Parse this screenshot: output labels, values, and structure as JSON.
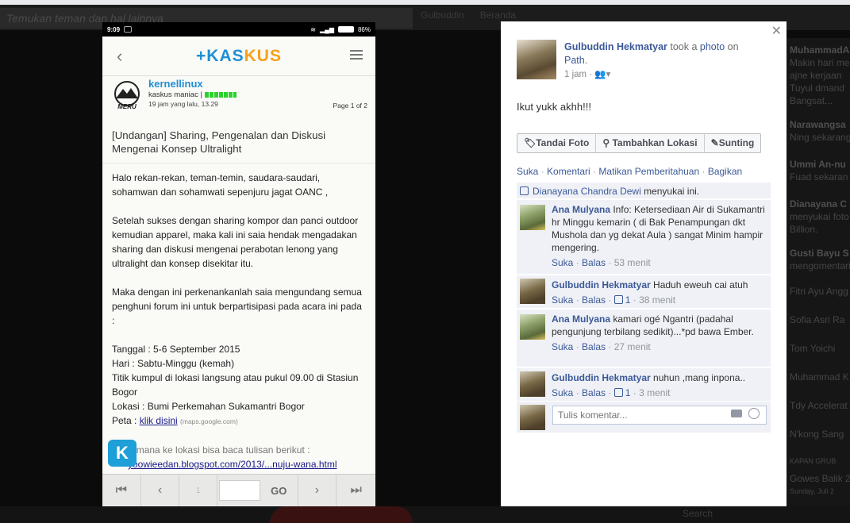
{
  "background": {
    "search_placeholder": "Temukan teman dan hal lainnya",
    "tabs": [
      "Gulbuddin",
      "Beranda"
    ],
    "sidebar": [
      {
        "name": "MuhammadA",
        "sub": "Makin hari me"
      },
      {
        "name": "",
        "sub": "ajne kerjaan"
      },
      {
        "name": "",
        "sub": "Tuyul dmand"
      },
      {
        "name": "",
        "sub": "Bangsat..."
      },
      {
        "name": "Narawangsa",
        "sub": "Ning sekarang"
      },
      {
        "name": "Ummi An-nu",
        "sub": "Fuad sekaran"
      },
      {
        "name": "Dianayana C",
        "sub": "menyukai foto"
      },
      {
        "name": "",
        "sub": "Billion."
      },
      {
        "name": "Gusti Bayu S",
        "sub": "mengomentari"
      },
      {
        "name": "",
        "sub": "Fitri Ayu Angg"
      },
      {
        "name": "",
        "sub": "Sofia Asri Ra"
      },
      {
        "name": "",
        "sub": "Tom Yoichi"
      },
      {
        "name": "",
        "sub": "Muhammad K"
      },
      {
        "name": "",
        "sub": "Tdy Accelerat"
      },
      {
        "name": "",
        "sub": "N'kong Sang"
      },
      {
        "name": "",
        "sub": "KAPAN GRUB"
      },
      {
        "name": "",
        "sub": "Gowes Balik 2"
      },
      {
        "name": "",
        "sub": "Sunday, Juli 2"
      }
    ],
    "bottom_right": "Search"
  },
  "phone": {
    "status_time": "9:09",
    "battery": "86%",
    "logo_prefix": "+KAS",
    "logo_suffix": "KUS",
    "username": "kernellinux",
    "rank": "kaskus maniac |",
    "post_time": "19 jam yang lalu, 13.29",
    "page": "Page 1 of 2",
    "title": "[Undangan] Sharing, Pengenalan dan Diskusi Mengenai Konsep Ultralight",
    "para1": "Halo rekan-rekan, teman-temin, saudara-saudari, sohamwan dan sohamwati sepenjuru jagat OANC ,",
    "para2": "Setelah sukses dengan sharing kompor dan panci outdoor kemudian apparel, maka kali ini saia hendak mengadakan sharing dan diskusi mengenai perabotan lenong yang ultralight dan konsep disekitar itu.",
    "para3": "Maka dengan ini perkenankanlah saia mengundang semua penghuni forum ini untuk berpartisipasi pada acara ini pada :",
    "tanggal": "Tanggal : 5-6 September 2015",
    "hari": "Hari : Sabtu-Minggu (kemah)",
    "titik": "Titik kumpul di lokasi langsung atau pukul 09.00 di Stasiun Bogor",
    "lokasi": "Lokasi : Bumi Perkemahan Sukamantri Bogor",
    "peta_label": "Peta : ",
    "peta_link": "klik disini",
    "peta_src": "(maps.google.com)",
    "bagaimana": "Bagaimana ke lokasi bisa baca tulisan berikut :",
    "blog_link": "yoowieedan.blogspot.com/2013/...nuju-wana.html",
    "badge": "K",
    "pager": {
      "first": "⏮",
      "prev": "‹",
      "num": "1",
      "go": "GO",
      "next": "›",
      "last": "⏭"
    }
  },
  "panel": {
    "poster_name": "Gulbuddin Hekmatyar",
    "took_a": " took a ",
    "photo": "photo",
    "on": " on ",
    "app": "Path",
    "time": "1 jam",
    "caption": "Ikut yukk akhh!!!",
    "actions": [
      "Tandai Foto",
      "Tambahkan Lokasi",
      "Sunting"
    ],
    "links": [
      "Suka",
      "Komentari",
      "Matikan Pemberitahuan",
      "Bagikan"
    ],
    "liker": "Dianayana Chandra Dewi",
    "likes_suffix": " menyukai ini.",
    "comments": [
      {
        "name": "Ana Mulyana",
        "text": " Info: Ketersediaan Air di Sukamantri hr Minggu kemarin ( di Bak Penampungan dkt Mushola dan yg dekat Aula ) sangat Minim hampir mengering.",
        "like": "Suka",
        "reply": "Balas",
        "count": "",
        "time": "53 menit"
      },
      {
        "name": "Gulbuddin Hekmatyar",
        "text": " Haduh eweuh cai atuh",
        "like": "Suka",
        "reply": "Balas",
        "count": "1",
        "time": "38 menit"
      },
      {
        "name": "Ana Mulyana",
        "text": " kamari ogé Ngantri (padahal pengunjung terbilang sedikit)...*pd bawa Ember.",
        "like": "Suka",
        "reply": "Balas",
        "count": "",
        "time": "27 menit"
      },
      {
        "name": "Gulbuddin Hekmatyar",
        "text": " nuhun ,mang inpona..",
        "like": "Suka",
        "reply": "Balas",
        "count": "1",
        "time": "3 menit"
      }
    ],
    "comment_placeholder": "Tulis komentar..."
  }
}
